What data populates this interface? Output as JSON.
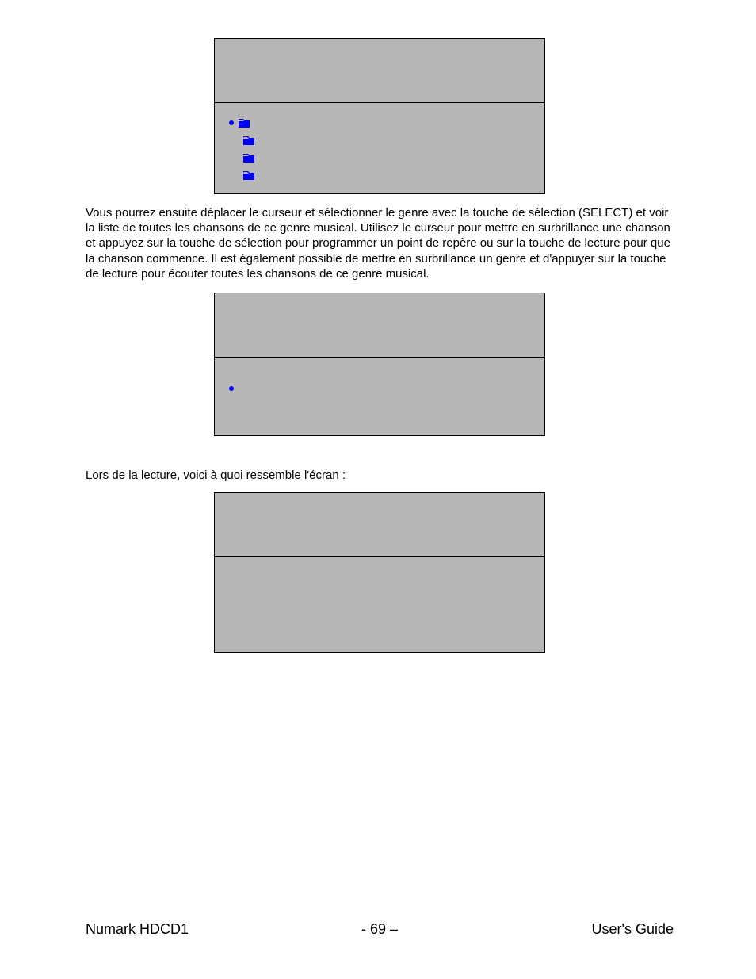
{
  "paragraphs": {
    "main": "Vous pourrez ensuite déplacer le curseur et sélectionner le genre avec la touche de sélection (SELECT) et voir la liste de toutes les chansons de ce genre musical.  Utilisez le curseur pour mettre en surbrillance une chanson et appuyez sur la touche de sélection pour programmer un point de repère ou sur la touche de lecture pour que la chanson commence.  Il est également possible de mettre en surbrillance un genre et d'appuyer sur la touche de lecture pour écouter toutes les chansons de ce genre musical.",
    "playback_intro": "Lors de la lecture, voici à quoi ressemble l'écran :"
  },
  "icons": {
    "folder": "folder-icon",
    "dot": "marker-dot"
  },
  "colors": {
    "screen_bg": "#b7b7b7",
    "icon_blue": "#0000ff"
  },
  "footer": {
    "left": "Numark HDCD1",
    "center": "- 69 –",
    "right": "User's Guide"
  }
}
